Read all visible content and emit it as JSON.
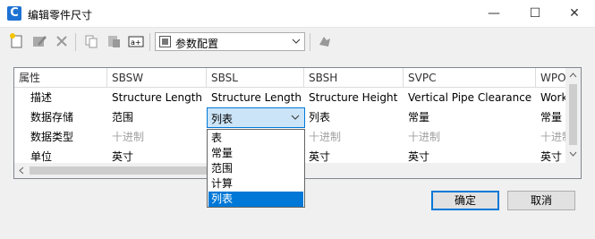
{
  "window": {
    "title": "编辑零件尺寸",
    "app_icon_letter": "C",
    "minimize": "—",
    "maximize": "☐",
    "close": "✕"
  },
  "toolbar": {
    "icons": [
      "new-icon",
      "edit-icon",
      "delete-icon",
      "copy-icon",
      "paste-icon",
      "rename-icon",
      "settings-icon"
    ],
    "combo_value": "参数配置"
  },
  "grid": {
    "columns": [
      "属性",
      "SBSW",
      "SBSL",
      "SBSH",
      "SVPC",
      "WPOI"
    ],
    "rows": [
      {
        "label": "描述",
        "cells": [
          "Structure Length",
          "Structure Length",
          "Structure Height",
          "Vertical Pipe Clearance",
          "Work"
        ]
      },
      {
        "label": "数据存储",
        "cells": [
          "范围",
          "列表",
          "列表",
          "常量",
          "常量"
        ]
      },
      {
        "label": "数据类型",
        "cells": [
          "十进制",
          "",
          "十进制",
          "十进制",
          "十进制"
        ]
      },
      {
        "label": "单位",
        "cells": [
          "英寸",
          "",
          "英寸",
          "英寸",
          "英寸"
        ]
      }
    ]
  },
  "dropdown": {
    "value": "列表",
    "options": [
      "表",
      "常量",
      "范围",
      "计算",
      "列表"
    ],
    "selected_index": 4
  },
  "buttons": {
    "ok": "确定",
    "cancel": "取消"
  },
  "colors": {
    "accent": "#0078d7",
    "selection_bg": "#cce4f7"
  }
}
